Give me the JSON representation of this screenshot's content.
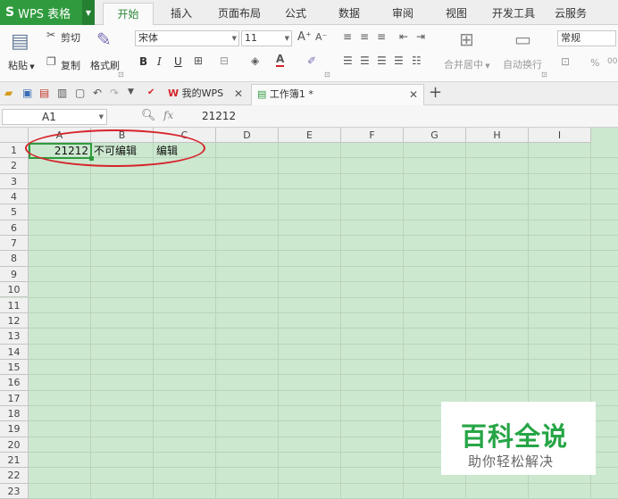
{
  "app": {
    "logo": "S",
    "name": "WPS 表格"
  },
  "menu": {
    "tabs": [
      "开始",
      "插入",
      "页面布局",
      "公式",
      "数据",
      "审阅",
      "视图",
      "开发工具",
      "云服务"
    ]
  },
  "ribbon": {
    "paste_label": "粘贴",
    "cut_label": "剪切",
    "copy_label": "复制",
    "format_painter_label": "格式刷",
    "font_name": "宋体",
    "font_size": "11",
    "bold": "B",
    "italic": "I",
    "underline": "U",
    "merge_center_label": "合并居中",
    "wrap_text_label": "自动换行",
    "number_format": "常规",
    "percent": "%",
    "thousands": "000"
  },
  "doc_tabs": [
    {
      "label": "我的WPS",
      "active": false
    },
    {
      "label": "工作簿1 *",
      "active": true
    }
  ],
  "formula_bar": {
    "cell_ref": "A1",
    "fx_label": "fx",
    "value": "21212"
  },
  "sheet": {
    "columns": [
      "A",
      "B",
      "C",
      "D",
      "E",
      "F",
      "G",
      "H",
      "I"
    ],
    "rows": [
      "1",
      "2",
      "3",
      "4",
      "5",
      "6",
      "7",
      "8",
      "9",
      "10",
      "11",
      "12",
      "13",
      "14",
      "15",
      "16",
      "17",
      "18",
      "19",
      "20",
      "21",
      "22",
      "23"
    ],
    "cells": {
      "A1": "21212",
      "B1": "不可编辑",
      "C1": "编辑"
    },
    "selected": "A1"
  },
  "watermark": {
    "title": "百科全说",
    "subtitle": "助你轻松解决"
  },
  "colors": {
    "accent": "#2f9b3e",
    "grid_bg": "#cce8cf",
    "annotation": "#d6242b"
  }
}
